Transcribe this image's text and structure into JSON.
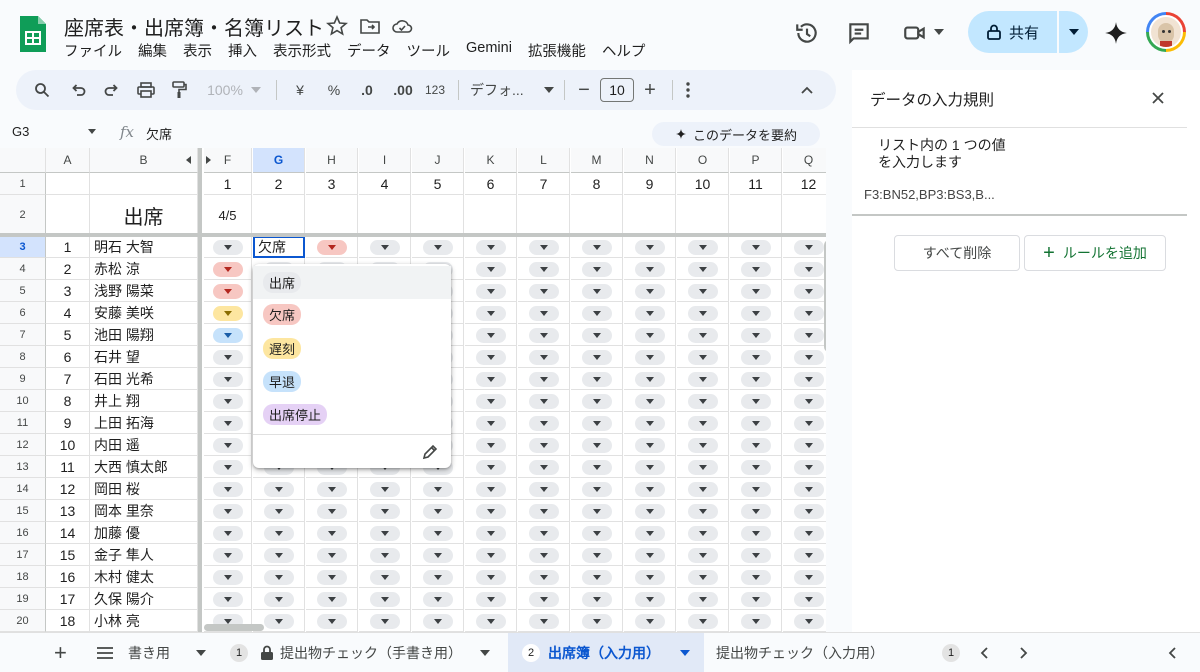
{
  "app": {
    "title": "座席表・出席簿・名簿リスト",
    "menu": [
      "ファイル",
      "編集",
      "表示",
      "挿入",
      "表示形式",
      "データ",
      "ツール",
      "Gemini",
      "拡張機能",
      "ヘルプ"
    ],
    "share_label": "共有"
  },
  "toolbar": {
    "zoom": "100%",
    "currency": "¥",
    "percent": "%",
    "dec_dec": ".0",
    "dec_inc": ".00",
    "numfmt": "123",
    "font": "デフォ...",
    "font_size": "10"
  },
  "formula_bar": {
    "cell_ref": "G3",
    "fx": "fx",
    "value": "欠席",
    "summarize_label": "このデータを要約"
  },
  "grid": {
    "columns": [
      "A",
      "B",
      "F",
      "G",
      "H",
      "I",
      "J",
      "K",
      "L",
      "M",
      "N",
      "O",
      "P",
      "Q"
    ],
    "row_numbers": [
      "1",
      "2",
      "3",
      "4",
      "5",
      "6",
      "7",
      "8",
      "9",
      "10",
      "11",
      "12",
      "13",
      "14",
      "15",
      "16",
      "17",
      "18",
      "19",
      "20"
    ],
    "row1_numbers": [
      "1",
      "2",
      "3",
      "4",
      "5",
      "6",
      "7",
      "8",
      "9",
      "10",
      "11",
      "12"
    ],
    "b2_title": "出席",
    "f2_value": "4/5",
    "editing_value": "欠席",
    "students": [
      {
        "no": "1",
        "name": "明石 大智"
      },
      {
        "no": "2",
        "name": "赤松 涼"
      },
      {
        "no": "3",
        "name": "浅野 陽菜"
      },
      {
        "no": "4",
        "name": "安藤 美咲"
      },
      {
        "no": "5",
        "name": "池田 陽翔"
      },
      {
        "no": "6",
        "name": "石井 望"
      },
      {
        "no": "7",
        "name": "石田 光希"
      },
      {
        "no": "8",
        "name": "井上 翔"
      },
      {
        "no": "9",
        "name": "上田 拓海"
      },
      {
        "no": "10",
        "name": "内田 遥"
      },
      {
        "no": "11",
        "name": "大西 慎太郎"
      },
      {
        "no": "12",
        "name": "岡田 桜"
      },
      {
        "no": "13",
        "name": "岡本 里奈"
      },
      {
        "no": "14",
        "name": "加藤 優"
      },
      {
        "no": "15",
        "name": "金子 隼人"
      },
      {
        "no": "16",
        "name": "木村 健太"
      },
      {
        "no": "17",
        "name": "久保 陽介"
      },
      {
        "no": "18",
        "name": "小林 亮"
      }
    ]
  },
  "dropdown": {
    "options": [
      {
        "label": "出席",
        "color": "#e8eaed"
      },
      {
        "label": "欠席",
        "color": "#f7c7c2"
      },
      {
        "label": "遅刻",
        "color": "#fde6a0"
      },
      {
        "label": "早退",
        "color": "#c6e2fb"
      },
      {
        "label": "出席停止",
        "color": "#e5d1f5"
      }
    ]
  },
  "panel": {
    "title": "データの入力規則",
    "rule_line1": "リスト内の 1 つの値",
    "rule_line2": "を入力します",
    "range": "F3:BN52,BP3:BS3,B...",
    "delete_all": "すべて削除",
    "add_rule": "ルールを追加"
  },
  "tabs": {
    "partial_tab": "書き用",
    "badge1": "1",
    "tab_locked": "提出物チェック（手書き用）",
    "badge2": "2",
    "tab_active": "出席簿（入力用）",
    "tab_next": "提出物チェック（入力用）",
    "badge3": "1"
  },
  "colors": {
    "accent": "#0b57d0",
    "share_bg": "#c2e7ff",
    "sheets_green": "#0f9d58"
  }
}
